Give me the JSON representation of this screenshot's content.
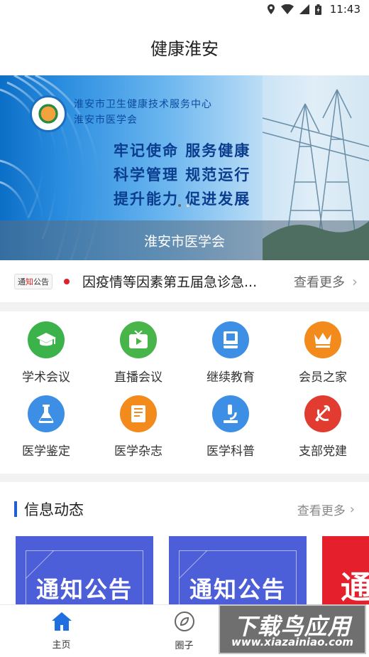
{
  "status_bar": {
    "time": "11:43"
  },
  "header": {
    "title": "健康淮安"
  },
  "banner": {
    "org_lines": [
      "淮安市卫生健康技术服务中心",
      "淮安市医学会"
    ],
    "slogans": [
      "牢记使命  服务健康",
      "科学管理  规范运行",
      "提升能力  促进发展"
    ],
    "caption": "淮安市医学会",
    "page_count": 2,
    "active_page": 1
  },
  "notice": {
    "badge_prefix": "通",
    "badge_red": "知",
    "badge_suffix": "公告",
    "text": "因疫情等因素第五届急诊急...",
    "more": "查看更多"
  },
  "menu": [
    {
      "label": "学术会议",
      "color": "#3cb34a",
      "icon": "graduation-cap-icon"
    },
    {
      "label": "直播会议",
      "color": "#47b549",
      "icon": "tv-icon"
    },
    {
      "label": "继续教育",
      "color": "#3d8fe6",
      "icon": "book-icon"
    },
    {
      "label": "会员之家",
      "color": "#f28a1c",
      "icon": "crown-icon"
    },
    {
      "label": "医学鉴定",
      "color": "#3d8fe6",
      "icon": "flask-icon"
    },
    {
      "label": "医学杂志",
      "color": "#f28a1c",
      "icon": "magazine-icon"
    },
    {
      "label": "医学科普",
      "color": "#3d8fe6",
      "icon": "microscope-icon"
    },
    {
      "label": "支部党建",
      "color": "#e23b2f",
      "icon": "party-emblem-icon"
    }
  ],
  "info_section": {
    "title": "信息动态",
    "more": "查看更多",
    "cards": [
      {
        "text": "通知公告",
        "color": "#4d5fd8"
      },
      {
        "text": "通知公告",
        "color": "#4d5fd8"
      },
      {
        "text": "通",
        "color": "#e51f2b"
      }
    ]
  },
  "bottom_nav": [
    {
      "label": "主页",
      "icon": "home-icon",
      "active": true
    },
    {
      "label": "圈子",
      "icon": "compass-icon",
      "active": false
    }
  ],
  "watermark": {
    "main": "下载鸟应用",
    "url": "www.xiazainiao.com"
  }
}
